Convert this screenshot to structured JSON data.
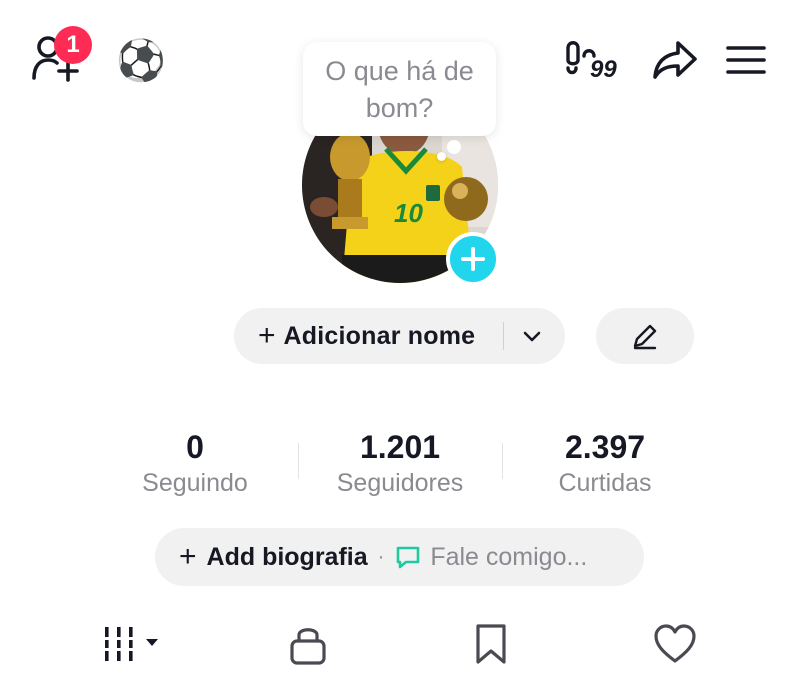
{
  "header": {
    "notification_count": "1",
    "ball_emoji": "⚽",
    "footprint_count": "99",
    "icons": [
      "add-friend-icon",
      "soccer-ball-icon",
      "footprint-icon",
      "share-icon",
      "menu-icon"
    ]
  },
  "profile": {
    "bubble_text": "O que há de bom?",
    "add_name_label": "Adicionar nome",
    "add_symbol": "+"
  },
  "stats": [
    {
      "value": "0",
      "label": "Seguindo"
    },
    {
      "value": "1.201",
      "label": "Seguidores"
    },
    {
      "value": "2.397",
      "label": "Curtidas"
    }
  ],
  "bio": {
    "add_label": "Add biografia",
    "separator": "·",
    "chat_label": "Fale comigo..."
  },
  "tabs": [
    {
      "icon": "grid-icon"
    },
    {
      "icon": "lock-icon"
    },
    {
      "icon": "bookmark-icon"
    },
    {
      "icon": "heart-icon"
    }
  ],
  "colors": {
    "badge": "#fe2c55",
    "avatar_add": "#20d5ec",
    "chat_icon": "#20c9a0",
    "pill_bg": "#f1f1f2",
    "muted_text": "#8a8b91"
  }
}
